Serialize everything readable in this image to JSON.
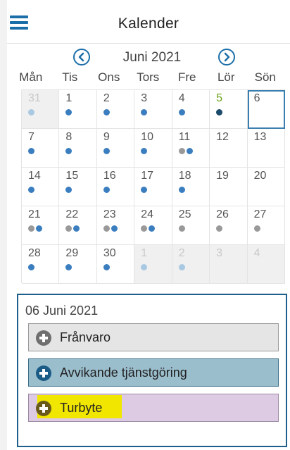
{
  "header": {
    "title": "Kalender"
  },
  "calendar": {
    "month": "Juni 2021",
    "weekdays": [
      "Mån",
      "Tis",
      "Ons",
      "Tors",
      "Fre",
      "Lör",
      "Sön"
    ],
    "weeks": [
      [
        {
          "day": "31",
          "muted": true,
          "dots": [
            "#a9c9e3"
          ]
        },
        {
          "day": "1",
          "dots": [
            "#3b7ec0"
          ]
        },
        {
          "day": "2",
          "dots": [
            "#3b7ec0"
          ]
        },
        {
          "day": "3",
          "dots": [
            "#3b7ec0"
          ]
        },
        {
          "day": "4",
          "dots": [
            "#3b7ec0"
          ]
        },
        {
          "day": "5",
          "today": true,
          "dots": [
            "#1b4a6b"
          ]
        },
        {
          "day": "6",
          "selected": true,
          "dots": []
        }
      ],
      [
        {
          "day": "7",
          "dots": [
            "#3b7ec0"
          ]
        },
        {
          "day": "8",
          "dots": [
            "#3b7ec0"
          ]
        },
        {
          "day": "9",
          "dots": [
            "#3b7ec0"
          ]
        },
        {
          "day": "10",
          "dots": [
            "#3b7ec0"
          ]
        },
        {
          "day": "11",
          "dots": [
            "#999999",
            "#3b7ec0"
          ]
        },
        {
          "day": "12",
          "dots": []
        },
        {
          "day": "13",
          "dots": []
        }
      ],
      [
        {
          "day": "14",
          "dots": [
            "#3b7ec0"
          ]
        },
        {
          "day": "15",
          "dots": [
            "#3b7ec0"
          ]
        },
        {
          "day": "16",
          "dots": [
            "#3b7ec0"
          ]
        },
        {
          "day": "17",
          "dots": [
            "#3b7ec0"
          ]
        },
        {
          "day": "18",
          "dots": [
            "#3b7ec0"
          ]
        },
        {
          "day": "19",
          "dots": []
        },
        {
          "day": "20",
          "dots": []
        }
      ],
      [
        {
          "day": "21",
          "dots": [
            "#999999",
            "#3b7ec0"
          ]
        },
        {
          "day": "22",
          "dots": [
            "#999999",
            "#3b7ec0"
          ]
        },
        {
          "day": "23",
          "dots": [
            "#999999",
            "#3b7ec0"
          ]
        },
        {
          "day": "24",
          "dots": [
            "#999999",
            "#3b7ec0"
          ]
        },
        {
          "day": "25",
          "dots": [
            "#999999"
          ]
        },
        {
          "day": "26",
          "dots": [
            "#999999"
          ]
        },
        {
          "day": "27",
          "dots": [
            "#999999"
          ]
        }
      ],
      [
        {
          "day": "28",
          "dots": [
            "#3b7ec0"
          ]
        },
        {
          "day": "29",
          "dots": [
            "#3b7ec0"
          ]
        },
        {
          "day": "30",
          "dots": [
            "#3b7ec0"
          ]
        },
        {
          "day": "1",
          "muted": true,
          "dots": [
            "#a9c9e3"
          ]
        },
        {
          "day": "2",
          "muted": true,
          "dots": [
            "#a9c9e3"
          ]
        },
        {
          "day": "3",
          "muted": true,
          "dots": []
        },
        {
          "day": "4",
          "muted": true,
          "dots": []
        }
      ]
    ]
  },
  "panel": {
    "date": "06 Juni 2021",
    "actions": {
      "franvaro": "Frånvaro",
      "avvikande": "Avvikande tjänstgöring",
      "turbyte": "Turbyte"
    }
  },
  "colors": {
    "accent": "#1c6ea8",
    "today": "#6aa11c",
    "highlight": "#f1e600"
  }
}
